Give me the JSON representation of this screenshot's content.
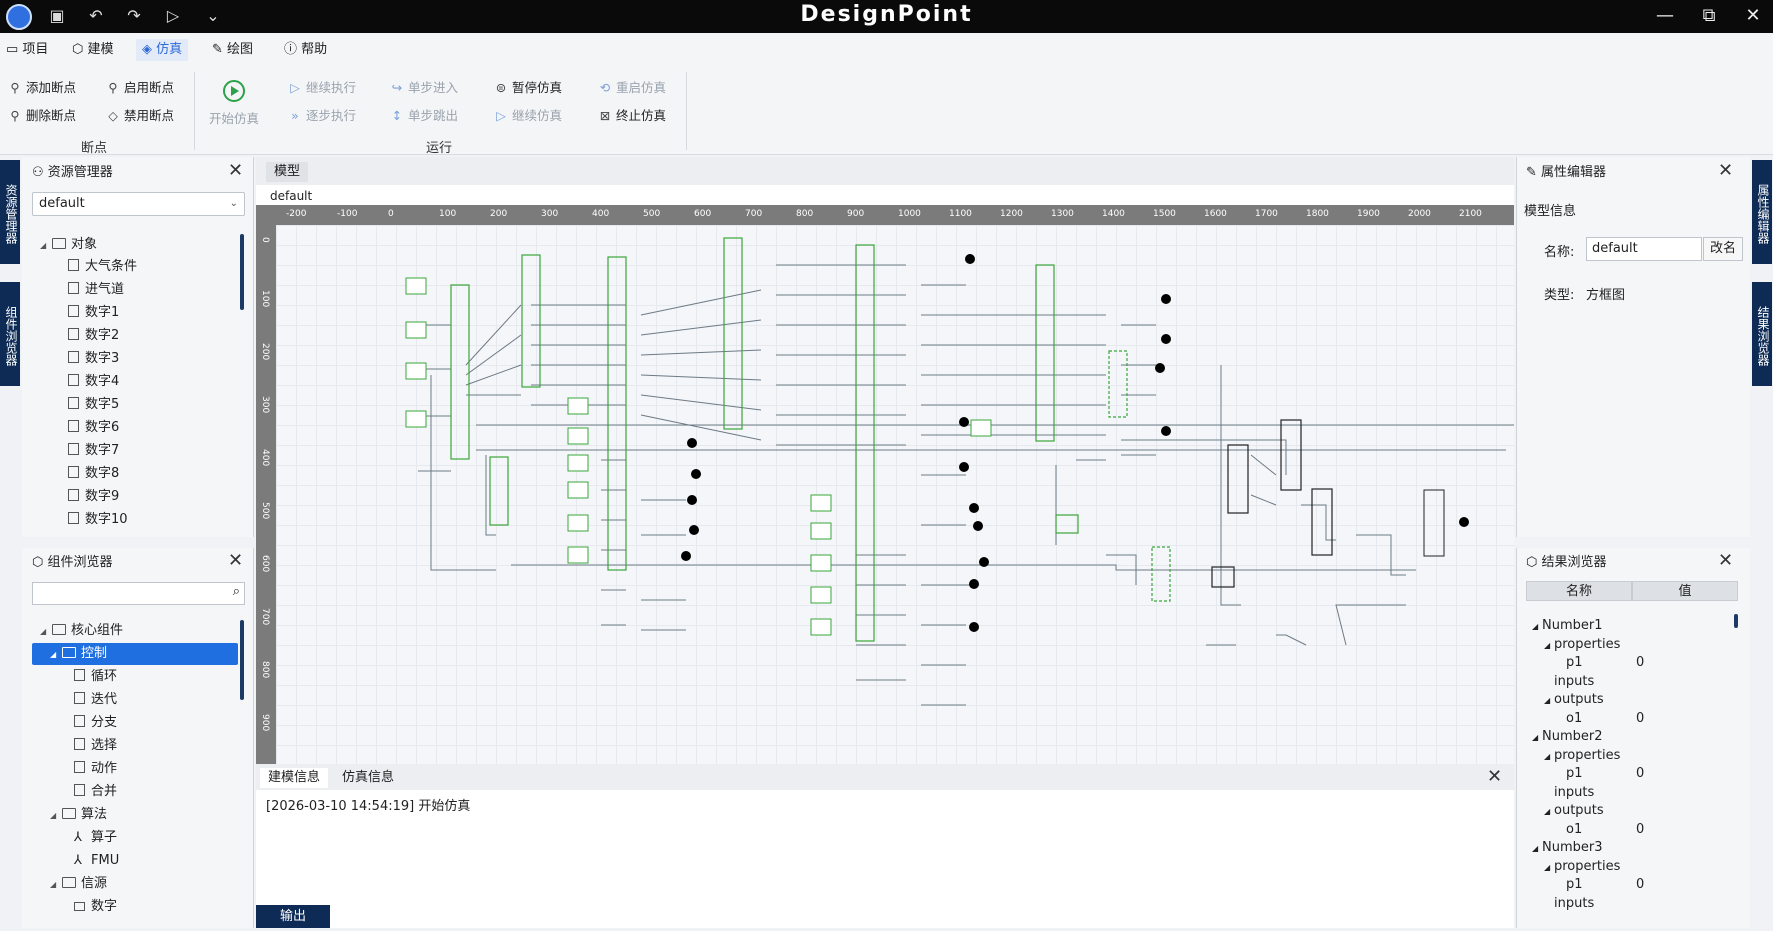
{
  "app": {
    "title": "DesignPoint"
  },
  "menu": {
    "items": [
      "项目",
      "建模",
      "仿真",
      "绘图",
      "帮助"
    ]
  },
  "ribbon": {
    "add_breakpoint": "添加断点",
    "delete_breakpoint": "删除断点",
    "enable_breakpoint": "启用断点",
    "disable_breakpoint": "禁用断点",
    "start_sim": "开始仿真",
    "continue_exec": "继续执行",
    "step_exec": "逐步执行",
    "step_in": "单步进入",
    "step_out": "单步跳出",
    "pause_sim": "暂停仿真",
    "continue_sim": "继续仿真",
    "restart_sim": "重启仿真",
    "stop_sim": "终止仿真",
    "group_breakpoint": "断点",
    "group_run": "运行"
  },
  "left_vtabs": [
    "资源管理器",
    "组件浏览器"
  ],
  "right_vtabs": [
    "属性编辑器",
    "结果浏览器"
  ],
  "resource_manager": {
    "title": "资源管理器",
    "selected": "default",
    "root": "对象",
    "items": [
      "大气条件",
      "进气道",
      "数字1",
      "数字2",
      "数字3",
      "数字4",
      "数字5",
      "数字6",
      "数字7",
      "数字8",
      "数字9",
      "数字10"
    ]
  },
  "component_browser": {
    "title": "组件浏览器",
    "search_placeholder": "",
    "root": "核心组件",
    "control": "控制",
    "control_items": [
      "循环",
      "迭代",
      "分支",
      "选择",
      "动作",
      "合并"
    ],
    "algo": "算法",
    "algo_items": [
      "算子",
      "FMU"
    ],
    "source": "信源",
    "source_items": [
      "数字"
    ]
  },
  "canvas": {
    "tab": "模型",
    "model_name": "default",
    "ruler_x": [
      "-200",
      "-100",
      "0",
      "100",
      "200",
      "300",
      "400",
      "500",
      "600",
      "700",
      "800",
      "900",
      "1000",
      "1100",
      "1200",
      "1300",
      "1400",
      "1500",
      "1600",
      "1700",
      "1800",
      "1900",
      "2000",
      "2100"
    ],
    "ruler_y": [
      "0",
      "100",
      "200",
      "300",
      "400",
      "500",
      "600",
      "700",
      "800",
      "900"
    ]
  },
  "output": {
    "tabs": [
      "建模信息",
      "仿真信息"
    ],
    "log": "[2026-03-10 14:54:19] 开始仿真",
    "bottom_tab": "输出"
  },
  "property_editor": {
    "title": "属性编辑器",
    "section": "模型信息",
    "name_label": "名称:",
    "name_value": "default",
    "rename_button": "改名",
    "type_label": "类型:",
    "type_value": "方框图"
  },
  "result_browser": {
    "title": "结果浏览器",
    "col_name": "名称",
    "col_value": "值",
    "rows": [
      {
        "label": "Number1",
        "level": 0,
        "val": ""
      },
      {
        "label": "properties",
        "level": 1,
        "val": ""
      },
      {
        "label": "p1",
        "level": 2,
        "val": "0"
      },
      {
        "label": "inputs",
        "level": 1,
        "val": ""
      },
      {
        "label": "outputs",
        "level": 1,
        "val": ""
      },
      {
        "label": "o1",
        "level": 2,
        "val": "0"
      },
      {
        "label": "Number2",
        "level": 0,
        "val": ""
      },
      {
        "label": "properties",
        "level": 1,
        "val": ""
      },
      {
        "label": "p1",
        "level": 2,
        "val": "0"
      },
      {
        "label": "inputs",
        "level": 1,
        "val": ""
      },
      {
        "label": "outputs",
        "level": 1,
        "val": ""
      },
      {
        "label": "o1",
        "level": 2,
        "val": "0"
      },
      {
        "label": "Number3",
        "level": 0,
        "val": ""
      },
      {
        "label": "properties",
        "level": 1,
        "val": ""
      },
      {
        "label": "p1",
        "level": 2,
        "val": "0"
      },
      {
        "label": "inputs",
        "level": 1,
        "val": ""
      }
    ]
  },
  "colors": {
    "accent": "#1f6fe0",
    "block_border": "#3aa63a",
    "dark_tab": "#0d2b55"
  }
}
